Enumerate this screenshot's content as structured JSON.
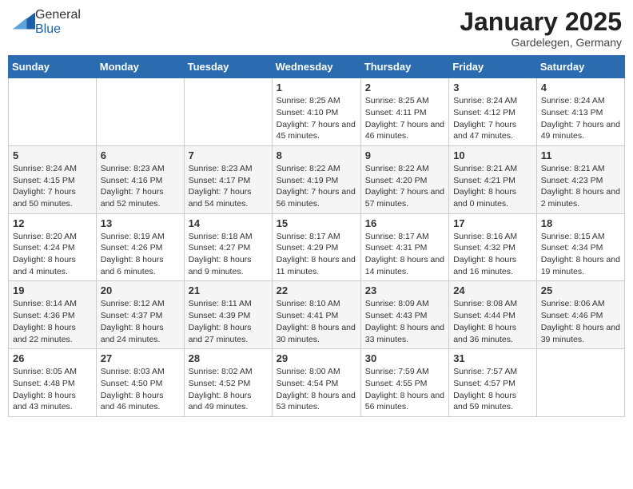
{
  "logo": {
    "general": "General",
    "blue": "Blue"
  },
  "title": "January 2025",
  "location": "Gardelegen, Germany",
  "days_header": [
    "Sunday",
    "Monday",
    "Tuesday",
    "Wednesday",
    "Thursday",
    "Friday",
    "Saturday"
  ],
  "weeks": [
    [
      {
        "day": "",
        "info": ""
      },
      {
        "day": "",
        "info": ""
      },
      {
        "day": "",
        "info": ""
      },
      {
        "day": "1",
        "info": "Sunrise: 8:25 AM\nSunset: 4:10 PM\nDaylight: 7 hours and 45 minutes."
      },
      {
        "day": "2",
        "info": "Sunrise: 8:25 AM\nSunset: 4:11 PM\nDaylight: 7 hours and 46 minutes."
      },
      {
        "day": "3",
        "info": "Sunrise: 8:24 AM\nSunset: 4:12 PM\nDaylight: 7 hours and 47 minutes."
      },
      {
        "day": "4",
        "info": "Sunrise: 8:24 AM\nSunset: 4:13 PM\nDaylight: 7 hours and 49 minutes."
      }
    ],
    [
      {
        "day": "5",
        "info": "Sunrise: 8:24 AM\nSunset: 4:15 PM\nDaylight: 7 hours and 50 minutes."
      },
      {
        "day": "6",
        "info": "Sunrise: 8:23 AM\nSunset: 4:16 PM\nDaylight: 7 hours and 52 minutes."
      },
      {
        "day": "7",
        "info": "Sunrise: 8:23 AM\nSunset: 4:17 PM\nDaylight: 7 hours and 54 minutes."
      },
      {
        "day": "8",
        "info": "Sunrise: 8:22 AM\nSunset: 4:19 PM\nDaylight: 7 hours and 56 minutes."
      },
      {
        "day": "9",
        "info": "Sunrise: 8:22 AM\nSunset: 4:20 PM\nDaylight: 7 hours and 57 minutes."
      },
      {
        "day": "10",
        "info": "Sunrise: 8:21 AM\nSunset: 4:21 PM\nDaylight: 8 hours and 0 minutes."
      },
      {
        "day": "11",
        "info": "Sunrise: 8:21 AM\nSunset: 4:23 PM\nDaylight: 8 hours and 2 minutes."
      }
    ],
    [
      {
        "day": "12",
        "info": "Sunrise: 8:20 AM\nSunset: 4:24 PM\nDaylight: 8 hours and 4 minutes."
      },
      {
        "day": "13",
        "info": "Sunrise: 8:19 AM\nSunset: 4:26 PM\nDaylight: 8 hours and 6 minutes."
      },
      {
        "day": "14",
        "info": "Sunrise: 8:18 AM\nSunset: 4:27 PM\nDaylight: 8 hours and 9 minutes."
      },
      {
        "day": "15",
        "info": "Sunrise: 8:17 AM\nSunset: 4:29 PM\nDaylight: 8 hours and 11 minutes."
      },
      {
        "day": "16",
        "info": "Sunrise: 8:17 AM\nSunset: 4:31 PM\nDaylight: 8 hours and 14 minutes."
      },
      {
        "day": "17",
        "info": "Sunrise: 8:16 AM\nSunset: 4:32 PM\nDaylight: 8 hours and 16 minutes."
      },
      {
        "day": "18",
        "info": "Sunrise: 8:15 AM\nSunset: 4:34 PM\nDaylight: 8 hours and 19 minutes."
      }
    ],
    [
      {
        "day": "19",
        "info": "Sunrise: 8:14 AM\nSunset: 4:36 PM\nDaylight: 8 hours and 22 minutes."
      },
      {
        "day": "20",
        "info": "Sunrise: 8:12 AM\nSunset: 4:37 PM\nDaylight: 8 hours and 24 minutes."
      },
      {
        "day": "21",
        "info": "Sunrise: 8:11 AM\nSunset: 4:39 PM\nDaylight: 8 hours and 27 minutes."
      },
      {
        "day": "22",
        "info": "Sunrise: 8:10 AM\nSunset: 4:41 PM\nDaylight: 8 hours and 30 minutes."
      },
      {
        "day": "23",
        "info": "Sunrise: 8:09 AM\nSunset: 4:43 PM\nDaylight: 8 hours and 33 minutes."
      },
      {
        "day": "24",
        "info": "Sunrise: 8:08 AM\nSunset: 4:44 PM\nDaylight: 8 hours and 36 minutes."
      },
      {
        "day": "25",
        "info": "Sunrise: 8:06 AM\nSunset: 4:46 PM\nDaylight: 8 hours and 39 minutes."
      }
    ],
    [
      {
        "day": "26",
        "info": "Sunrise: 8:05 AM\nSunset: 4:48 PM\nDaylight: 8 hours and 43 minutes."
      },
      {
        "day": "27",
        "info": "Sunrise: 8:03 AM\nSunset: 4:50 PM\nDaylight: 8 hours and 46 minutes."
      },
      {
        "day": "28",
        "info": "Sunrise: 8:02 AM\nSunset: 4:52 PM\nDaylight: 8 hours and 49 minutes."
      },
      {
        "day": "29",
        "info": "Sunrise: 8:00 AM\nSunset: 4:54 PM\nDaylight: 8 hours and 53 minutes."
      },
      {
        "day": "30",
        "info": "Sunrise: 7:59 AM\nSunset: 4:55 PM\nDaylight: 8 hours and 56 minutes."
      },
      {
        "day": "31",
        "info": "Sunrise: 7:57 AM\nSunset: 4:57 PM\nDaylight: 8 hours and 59 minutes."
      },
      {
        "day": "",
        "info": ""
      }
    ]
  ]
}
